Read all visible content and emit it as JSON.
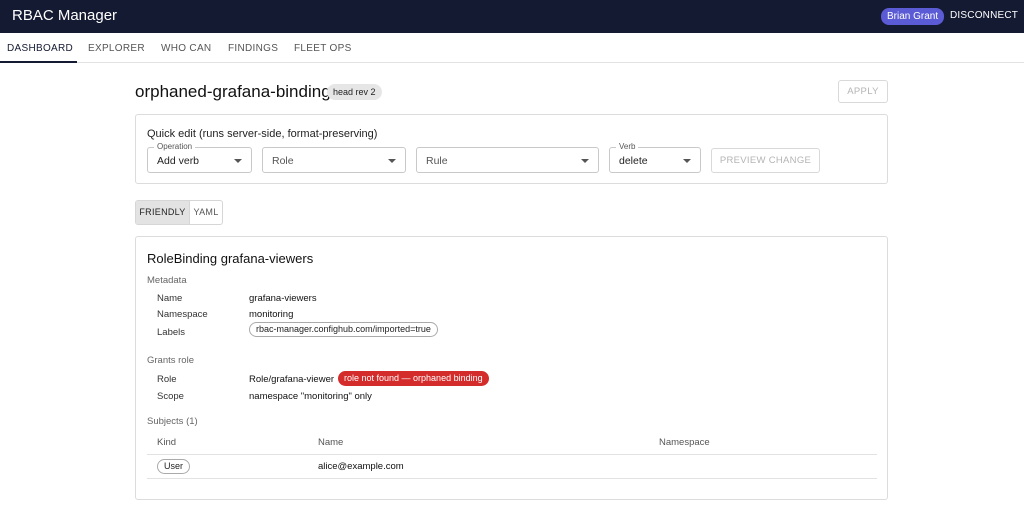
{
  "app": {
    "title": "RBAC Manager",
    "user": "Brian Grant",
    "disconnect_label": "DISCONNECT"
  },
  "tabs": [
    {
      "label": "DASHBOARD",
      "active": true
    },
    {
      "label": "EXPLORER"
    },
    {
      "label": "WHO CAN"
    },
    {
      "label": "FINDINGS"
    },
    {
      "label": "FLEET OPS"
    }
  ],
  "header": {
    "title": "orphaned-grafana-binding",
    "rev_chip": "head rev 2",
    "apply_label": "APPLY"
  },
  "quick_edit": {
    "title": "Quick edit (runs server-side, format-preserving)",
    "operation": {
      "legend": "Operation",
      "value": "Add verb"
    },
    "role": {
      "value": "Role"
    },
    "rule": {
      "value": "Rule"
    },
    "verb": {
      "legend": "Verb",
      "value": "delete"
    },
    "preview_label": "PREVIEW CHANGE"
  },
  "view_toggle": {
    "friendly": "FRIENDLY",
    "yaml": "YAML",
    "selected": "FRIENDLY"
  },
  "binding": {
    "title": "RoleBinding grafana-viewers",
    "metadata_heading": "Metadata",
    "name_label": "Name",
    "name": "grafana-viewers",
    "namespace_label": "Namespace",
    "namespace": "monitoring",
    "labels_label": "Labels",
    "label_chip": "rbac-manager.confighub.com/imported=true",
    "grants_heading": "Grants role",
    "role_label": "Role",
    "role": "Role/grafana-viewer",
    "role_error": "role not found — orphaned binding",
    "scope_label": "Scope",
    "scope": "namespace \"monitoring\" only",
    "subjects_heading": "Subjects (1)",
    "columns": [
      "Kind",
      "Name",
      "Namespace"
    ],
    "subjects": [
      {
        "kind": "User",
        "name": "alice@example.com",
        "namespace": ""
      }
    ]
  },
  "colors": {
    "appbar": "#151a33",
    "user_chip": "#5b5bd6",
    "error": "#d42b2b"
  }
}
